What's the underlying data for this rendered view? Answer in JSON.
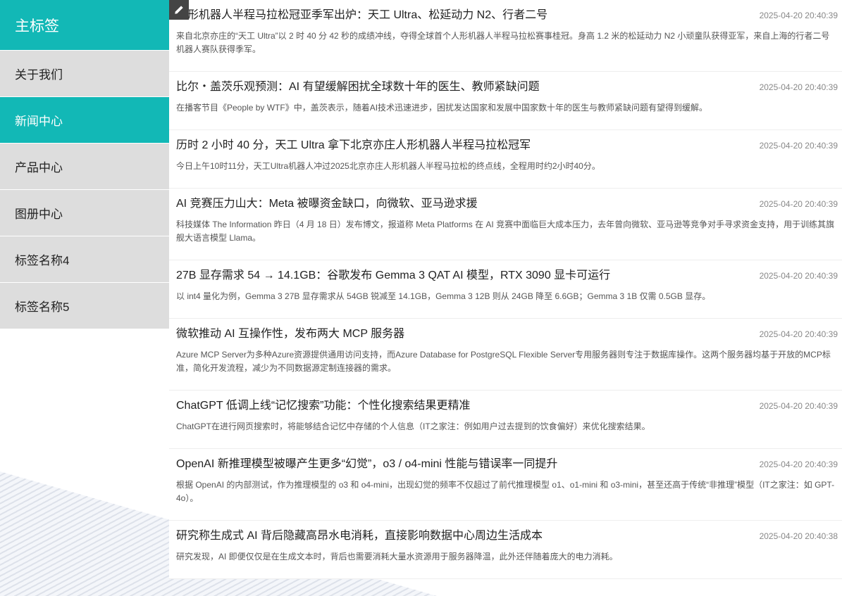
{
  "sidebar": {
    "main_label": "主标签",
    "items": [
      {
        "label": "关于我们"
      },
      {
        "label": "新闻中心"
      },
      {
        "label": "产品中心"
      },
      {
        "label": "图册中心"
      },
      {
        "label": "标签名称4"
      },
      {
        "label": "标签名称5"
      }
    ],
    "active_index": 1
  },
  "news": [
    {
      "title": "人形机器人半程马拉松冠亚季军出炉：天工 Ultra、松延动力 N2、行者二号",
      "date": "2025-04-20 20:40:39",
      "summary": "来自北京亦庄的“天工 Ultra”以 2 时 40 分 42 秒的成绩冲线，夺得全球首个人形机器人半程马拉松赛事桂冠。身高 1.2 米的松延动力 N2 小顽童队获得亚军，来自上海的行者二号机器人赛队获得季军。"
    },
    {
      "title": "比尔・盖茨乐观预测：AI 有望缓解困扰全球数十年的医生、教师紧缺问题",
      "date": "2025-04-20 20:40:39",
      "summary": "在播客节目《People by WTF》中，盖茨表示，随着AI技术迅速进步，困扰发达国家和发展中国家数十年的医生与教师紧缺问题有望得到缓解。"
    },
    {
      "title": "历时 2 小时 40 分，天工 Ultra 拿下北京亦庄人形机器人半程马拉松冠军",
      "date": "2025-04-20 20:40:39",
      "summary": "今日上午10时11分，天工Ultra机器人冲过2025北京亦庄人形机器人半程马拉松的终点线，全程用时约2小时40分。"
    },
    {
      "title": "AI 竞赛压力山大：Meta 被曝资金缺口，向微软、亚马逊求援",
      "date": "2025-04-20 20:40:39",
      "summary": "科技媒体 The Information 昨日（4 月 18 日）发布博文，报道称 Meta Platforms 在 AI 竞赛中面临巨大成本压力，去年曾向微软、亚马逊等竞争对手寻求资金支持，用于训练其旗舰大语言模型 Llama。"
    },
    {
      "title": "27B 显存需求 54 → 14.1GB：谷歌发布 Gemma 3 QAT AI 模型，RTX 3090 显卡可运行",
      "date": "2025-04-20 20:40:39",
      "summary": "以 int4 量化为例，Gemma 3 27B 显存需求从 54GB 锐减至 14.1GB，Gemma 3 12B 则从 24GB 降至 6.6GB；Gemma 3 1B 仅需 0.5GB 显存。"
    },
    {
      "title": "微软推动 AI 互操作性，发布两大 MCP 服务器",
      "date": "2025-04-20 20:40:39",
      "summary": "Azure MCP Server为多种Azure资源提供通用访问支持，而Azure Database for PostgreSQL Flexible Server专用服务器则专注于数据库操作。这两个服务器均基于开放的MCP标准，简化开发流程，减少为不同数据源定制连接器的需求。"
    },
    {
      "title": "ChatGPT 低调上线“记忆搜索”功能：个性化搜索结果更精准",
      "date": "2025-04-20 20:40:39",
      "summary": "ChatGPT在进行网页搜索时，将能够结合记忆中存储的个人信息（IT之家注：例如用户过去提到的饮食偏好）来优化搜索结果。"
    },
    {
      "title": "OpenAI 新推理模型被曝产生更多“幻觉”，o3 / o4-mini 性能与错误率一同提升",
      "date": "2025-04-20 20:40:39",
      "summary": "根据 OpenAI 的内部测试，作为推理模型的 o3 和 o4-mini，出现幻觉的频率不仅超过了前代推理模型 o1、o1-mini 和 o3-mini，甚至还高于传统“非推理”模型（IT之家注：如 GPT-4o）。"
    },
    {
      "title": "研究称生成式 AI 背后隐藏高昂水电消耗，直接影响数据中心周边生活成本",
      "date": "2025-04-20 20:40:38",
      "summary": "研究发现，AI 即便仅仅是在生成文本时，背后也需要消耗大量水资源用于服务器降温，此外还伴随着庞大的电力消耗。"
    }
  ],
  "icons": {
    "edit": "pencil-icon"
  },
  "colors": {
    "accent": "#12b8b6",
    "sidebar_bg": "#dddddd"
  }
}
